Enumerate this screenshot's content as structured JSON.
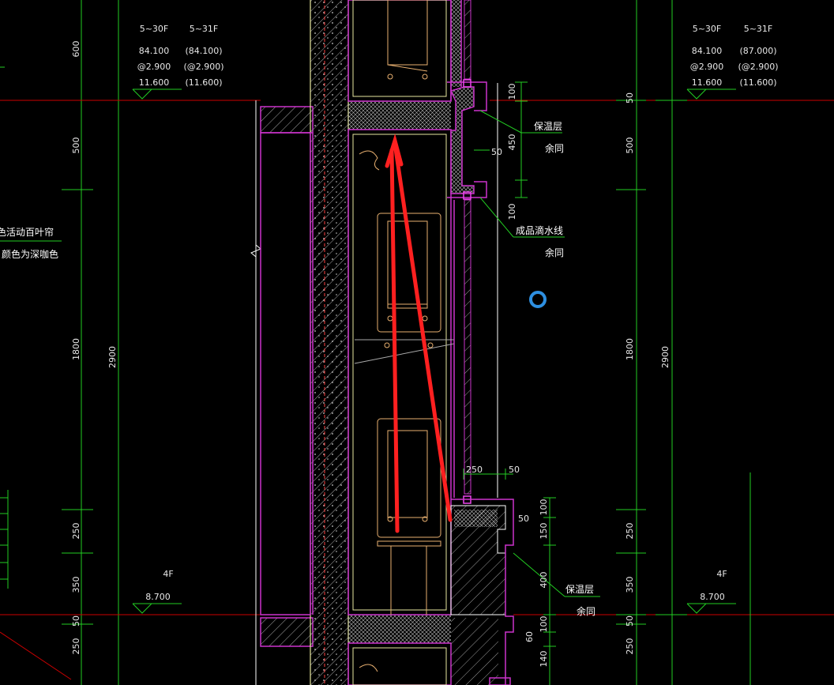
{
  "colors": {
    "background": "#000000",
    "dimension_line": "#22cc22",
    "floor_line": "#cc0000",
    "wall_outline": "#cc33cc",
    "hatch": "#bbbbbb",
    "furniture": "#e8b070",
    "annotation_arrow": "#ff2020",
    "cursor": "#2e8fe0",
    "text": "#ffffff"
  },
  "left_level_table": {
    "headers": [
      "5~30F",
      "5~31F"
    ],
    "rows": [
      [
        "84.100",
        "(84.100)"
      ],
      [
        "@2.900",
        "(@2.900)"
      ],
      [
        "11.600",
        "(11.600)"
      ]
    ]
  },
  "right_level_table": {
    "headers": [
      "5~30F",
      "5~31F"
    ],
    "rows": [
      [
        "84.100",
        "(87.000)"
      ],
      [
        "@2.900",
        "(@2.900)"
      ],
      [
        "11.600",
        "(11.600)"
      ]
    ]
  },
  "left_dims": {
    "d600": "600",
    "d500": "500",
    "d1800": "1800",
    "d2900": "2900",
    "d250a": "250",
    "d350": "350",
    "d50": "50",
    "d250b": "250"
  },
  "right_dims": {
    "d50": "50",
    "d500": "500",
    "d1800": "1800",
    "d2900": "2900",
    "d250a": "250",
    "d350": "350",
    "d50b": "50",
    "d250b": "250"
  },
  "left_floor_label": {
    "floor": "4F",
    "level": "8.700"
  },
  "right_floor_label": {
    "floor": "4F",
    "level": "8.700"
  },
  "left_note": {
    "line1": "色活动百叶帘",
    "line2": "颜色为深咖色"
  },
  "detail_dims": {
    "top100": "100",
    "d450": "450",
    "d50": "50",
    "bot100": "100",
    "d250": "250",
    "d50b": "50",
    "d100c": "100",
    "d150": "150",
    "d50c": "50",
    "d400": "400",
    "d100d": "100",
    "d60": "60",
    "d140": "140"
  },
  "callouts": {
    "insulation_top": "保温层",
    "same_top": "余同",
    "drip_line": "成品滴水线",
    "same_mid": "余同",
    "insulation_bottom": "保温层",
    "same_bottom": "余同"
  }
}
